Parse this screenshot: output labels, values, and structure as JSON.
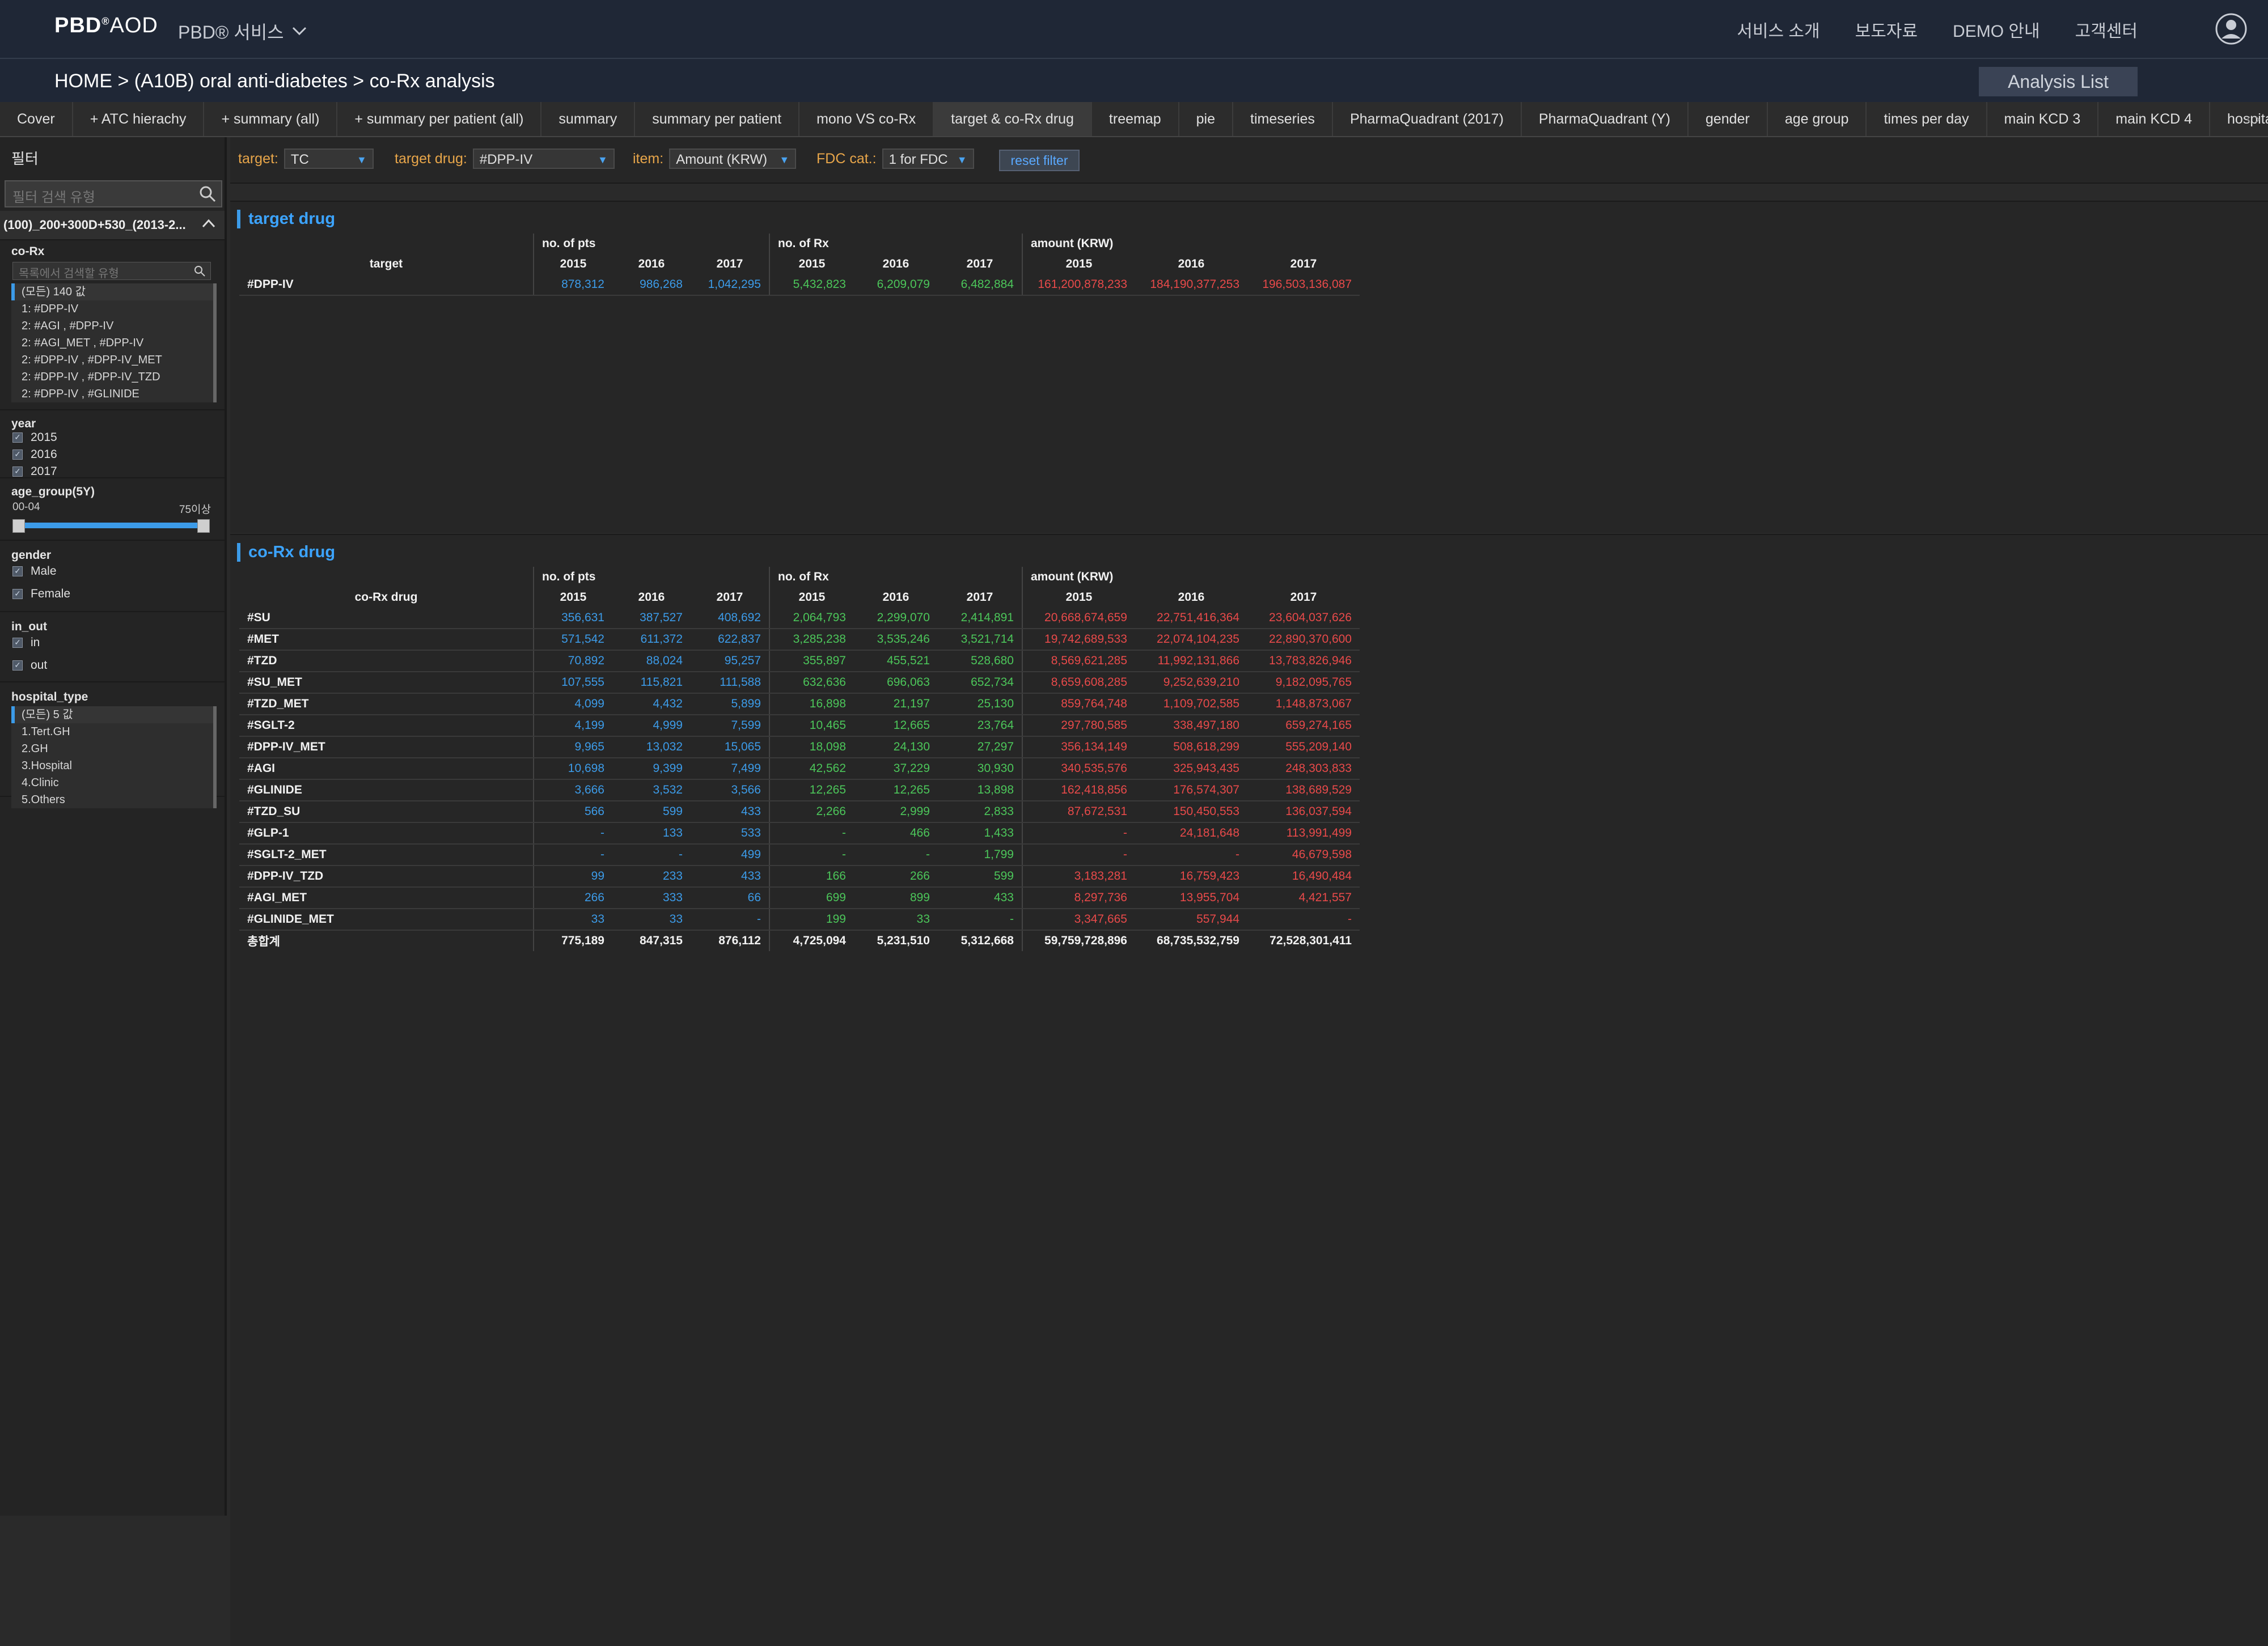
{
  "header": {
    "logo_bold": "PBD",
    "logo_reg": "®",
    "logo_light": "AOD",
    "service_menu": "PBD® 서비스",
    "links": [
      "서비스 소개",
      "보도자료",
      "DEMO 안내",
      "고객센터"
    ]
  },
  "breadcrumb": {
    "text": "HOME >  (A10B) oral anti-diabetes > co-Rx analysis",
    "analysis_list": "Analysis List"
  },
  "tabs": {
    "items": [
      "Cover",
      "+ ATC hierachy",
      "+ summary (all)",
      "+ summary per patient (all)",
      "summary",
      "summary per patient",
      "mono VS co-Rx",
      "target & co-Rx drug",
      "treemap",
      "pie",
      "timeseries",
      "PharmaQuadrant (2017)",
      "PharmaQuadrant (Y)",
      "gender",
      "age group",
      "times per day",
      "main KCD 3",
      "main KCD 4",
      "hospital typ"
    ],
    "active_index": 7
  },
  "sidebar": {
    "title": "필터",
    "search_placeholder": "필터 검색 유형",
    "selection_header": "(100)_200+300D+530_(2013-2...",
    "corx": {
      "label": "co-Rx",
      "search_placeholder": "목록에서 검색할 유형",
      "items": [
        "(모든) 140 값",
        "1:  #DPP-IV",
        "2:  #AGI ,  #DPP-IV",
        "2:  #AGI_MET ,  #DPP-IV",
        "2:  #DPP-IV ,  #DPP-IV_MET",
        "2:  #DPP-IV ,  #DPP-IV_TZD",
        "2:  #DPP-IV ,  #GLINIDE"
      ]
    },
    "year": {
      "label": "year",
      "items": [
        "2015",
        "2016",
        "2017"
      ]
    },
    "age_group": {
      "label": "age_group(5Y)",
      "min": "00-04",
      "max": "75이상"
    },
    "gender": {
      "label": "gender",
      "items": [
        "Male",
        "Female"
      ]
    },
    "in_out": {
      "label": "in_out",
      "items": [
        "in",
        "out"
      ]
    },
    "hospital_type": {
      "label": "hospital_type",
      "items": [
        "(모든) 5 값",
        "1.Tert.GH",
        "2.GH",
        "3.Hospital",
        "4.Clinic",
        "5.Others"
      ]
    }
  },
  "filters": {
    "target_label": "target:",
    "target_value": "TC",
    "target_drug_label": "target drug:",
    "target_drug_value": "#DPP-IV",
    "item_label": "item:",
    "item_value": "Amount (KRW)",
    "fdc_label": "FDC cat.:",
    "fdc_value": "1 for FDC",
    "reset": "reset filter"
  },
  "target_table": {
    "title": "target drug",
    "row_header": "target",
    "groups": [
      "no. of pts",
      "no. of Rx",
      "amount (KRW)"
    ],
    "years": [
      "2015",
      "2016",
      "2017"
    ],
    "rows": [
      {
        "name": "#DPP-IV",
        "pts": [
          "878,312",
          "986,268",
          "1,042,295"
        ],
        "rx": [
          "5,432,823",
          "6,209,079",
          "6,482,884"
        ],
        "amt": [
          "161,200,878,233",
          "184,190,377,253",
          "196,503,136,087"
        ]
      }
    ]
  },
  "corx_table": {
    "title": "co-Rx drug",
    "row_header": "co-Rx drug",
    "groups": [
      "no. of pts",
      "no. of Rx",
      "amount (KRW)"
    ],
    "years": [
      "2015",
      "2016",
      "2017"
    ],
    "rows": [
      {
        "name": "#SU",
        "pts": [
          "356,631",
          "387,527",
          "408,692"
        ],
        "rx": [
          "2,064,793",
          "2,299,070",
          "2,414,891"
        ],
        "amt": [
          "20,668,674,659",
          "22,751,416,364",
          "23,604,037,626"
        ]
      },
      {
        "name": "#MET",
        "pts": [
          "571,542",
          "611,372",
          "622,837"
        ],
        "rx": [
          "3,285,238",
          "3,535,246",
          "3,521,714"
        ],
        "amt": [
          "19,742,689,533",
          "22,074,104,235",
          "22,890,370,600"
        ]
      },
      {
        "name": "#TZD",
        "pts": [
          "70,892",
          "88,024",
          "95,257"
        ],
        "rx": [
          "355,897",
          "455,521",
          "528,680"
        ],
        "amt": [
          "8,569,621,285",
          "11,992,131,866",
          "13,783,826,946"
        ]
      },
      {
        "name": "#SU_MET",
        "pts": [
          "107,555",
          "115,821",
          "111,588"
        ],
        "rx": [
          "632,636",
          "696,063",
          "652,734"
        ],
        "amt": [
          "8,659,608,285",
          "9,252,639,210",
          "9,182,095,765"
        ]
      },
      {
        "name": "#TZD_MET",
        "pts": [
          "4,099",
          "4,432",
          "5,899"
        ],
        "rx": [
          "16,898",
          "21,197",
          "25,130"
        ],
        "amt": [
          "859,764,748",
          "1,109,702,585",
          "1,148,873,067"
        ]
      },
      {
        "name": "#SGLT-2",
        "pts": [
          "4,199",
          "4,999",
          "7,599"
        ],
        "rx": [
          "10,465",
          "12,665",
          "23,764"
        ],
        "amt": [
          "297,780,585",
          "338,497,180",
          "659,274,165"
        ]
      },
      {
        "name": "#DPP-IV_MET",
        "pts": [
          "9,965",
          "13,032",
          "15,065"
        ],
        "rx": [
          "18,098",
          "24,130",
          "27,297"
        ],
        "amt": [
          "356,134,149",
          "508,618,299",
          "555,209,140"
        ]
      },
      {
        "name": "#AGI",
        "pts": [
          "10,698",
          "9,399",
          "7,499"
        ],
        "rx": [
          "42,562",
          "37,229",
          "30,930"
        ],
        "amt": [
          "340,535,576",
          "325,943,435",
          "248,303,833"
        ]
      },
      {
        "name": "#GLINIDE",
        "pts": [
          "3,666",
          "3,532",
          "3,566"
        ],
        "rx": [
          "12,265",
          "12,265",
          "13,898"
        ],
        "amt": [
          "162,418,856",
          "176,574,307",
          "138,689,529"
        ]
      },
      {
        "name": "#TZD_SU",
        "pts": [
          "566",
          "599",
          "433"
        ],
        "rx": [
          "2,266",
          "2,999",
          "2,833"
        ],
        "amt": [
          "87,672,531",
          "150,450,553",
          "136,037,594"
        ]
      },
      {
        "name": "#GLP-1",
        "pts": [
          "-",
          "133",
          "533"
        ],
        "rx": [
          "-",
          "466",
          "1,433"
        ],
        "amt": [
          "-",
          "24,181,648",
          "113,991,499"
        ]
      },
      {
        "name": "#SGLT-2_MET",
        "pts": [
          "-",
          "-",
          "499"
        ],
        "rx": [
          "-",
          "-",
          "1,799"
        ],
        "amt": [
          "-",
          "-",
          "46,679,598"
        ]
      },
      {
        "name": "#DPP-IV_TZD",
        "pts": [
          "99",
          "233",
          "433"
        ],
        "rx": [
          "166",
          "266",
          "599"
        ],
        "amt": [
          "3,183,281",
          "16,759,423",
          "16,490,484"
        ]
      },
      {
        "name": "#AGI_MET",
        "pts": [
          "266",
          "333",
          "66"
        ],
        "rx": [
          "699",
          "899",
          "433"
        ],
        "amt": [
          "8,297,736",
          "13,955,704",
          "4,421,557"
        ]
      },
      {
        "name": "#GLINIDE_MET",
        "pts": [
          "33",
          "33",
          "-"
        ],
        "rx": [
          "199",
          "33",
          "-"
        ],
        "amt": [
          "3,347,665",
          "557,944",
          "-"
        ]
      }
    ],
    "total": {
      "name": "총합계",
      "pts": [
        "775,189",
        "847,315",
        "876,112"
      ],
      "rx": [
        "4,725,094",
        "5,231,510",
        "5,312,668"
      ],
      "amt": [
        "59,759,728,896",
        "68,735,532,759",
        "72,528,301,411"
      ]
    }
  },
  "colors": {
    "pts": "#3c9be8",
    "rx": "#4cc65a",
    "amt": "#e84a4a",
    "accent": "#3c9be8"
  }
}
